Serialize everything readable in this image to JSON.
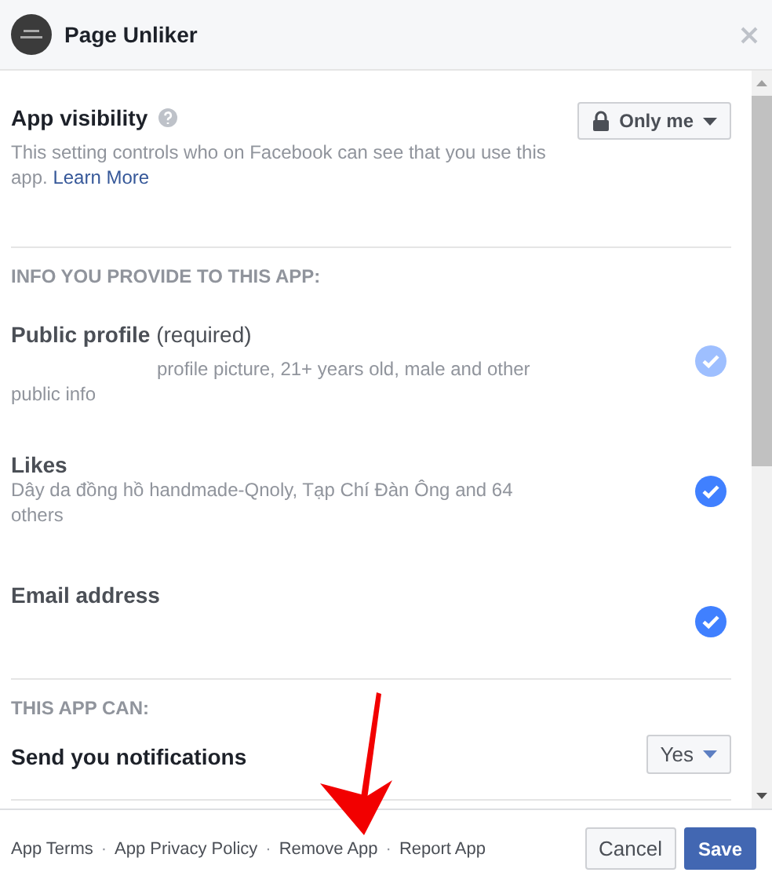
{
  "window": {
    "title": "Page Unliker"
  },
  "visibility": {
    "label": "App visibility",
    "description": "This setting controls who on Facebook can see that you use this app.",
    "link": "Learn More",
    "dropdown": "Only me"
  },
  "info_section": {
    "heading": "INFO YOU PROVIDE TO THIS APP:",
    "items": [
      {
        "title": "Public profile",
        "note": "(required)",
        "description": "profile picture, 21+ years old, male and other public info",
        "checked": true,
        "disabled": true
      },
      {
        "title": "Likes",
        "description": "Dây da đồng hồ handmade-Qnoly, Tạp Chí Đàn Ông and 64 others",
        "checked": true,
        "disabled": false
      },
      {
        "title": "Email address",
        "checked": true,
        "disabled": false
      }
    ]
  },
  "permissions_section": {
    "heading": "THIS APP CAN:",
    "items": [
      {
        "title": "Send you notifications",
        "dropdown": "Yes"
      }
    ]
  },
  "footer": {
    "links": [
      "App Terms",
      "App Privacy Policy",
      "Remove App",
      "Report App"
    ],
    "separator": "·",
    "buttons": [
      {
        "label": "Cancel",
        "kind": "secondary"
      },
      {
        "label": "Save",
        "kind": "primary"
      }
    ]
  }
}
